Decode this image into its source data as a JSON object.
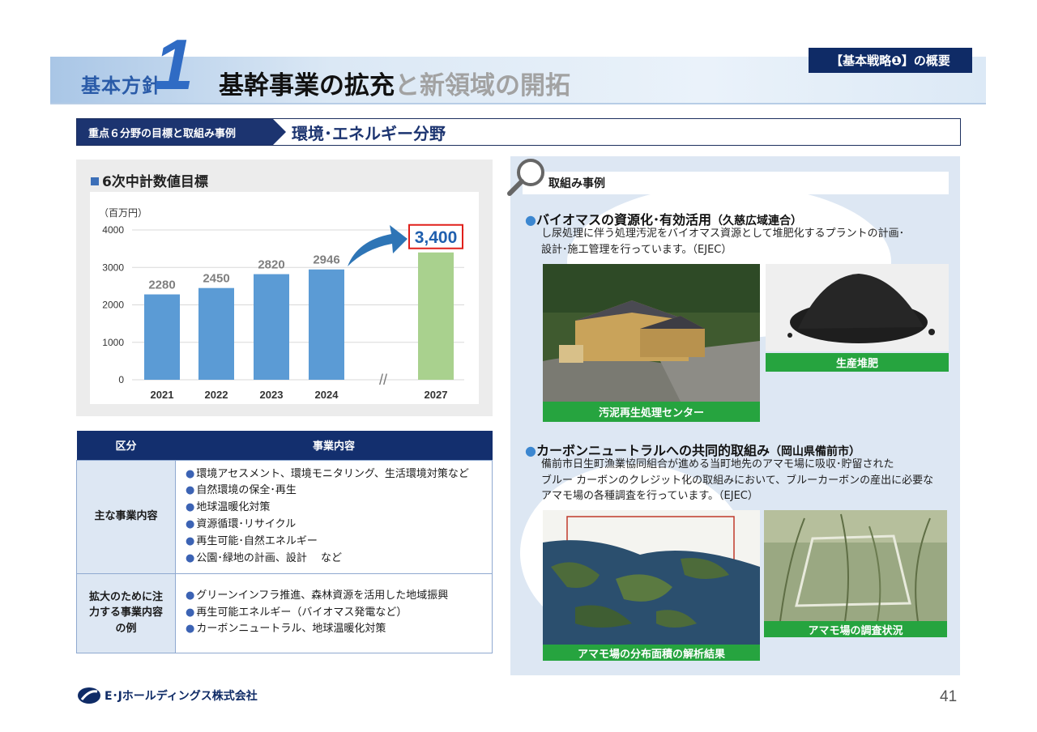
{
  "header": {
    "policy_label": "基本方針",
    "policy_number": "1",
    "title_main": "基幹事業の拡充",
    "title_gray": "と新領域の開拓",
    "badge": "【基本戦略❶】の概要"
  },
  "section": {
    "label": "重点６分野の目標と取組み事例",
    "title": "環境･エネルギー分野"
  },
  "chart": {
    "heading": "6次中計数値目標",
    "unit": "（百万円）",
    "target_label": "3,400"
  },
  "chart_data": {
    "type": "bar",
    "categories": [
      "2021",
      "2022",
      "2023",
      "2024",
      "2027"
    ],
    "values": [
      2280,
      2450,
      2820,
      2946,
      3400
    ],
    "data_labels": [
      "2280",
      "2450",
      "2820",
      "2946",
      "3,400"
    ],
    "ylim": [
      0,
      4000
    ],
    "yticks": [
      "0",
      "1000",
      "2000",
      "3000",
      "4000"
    ],
    "colors": {
      "actual": "#5b9bd5",
      "target": "#a9d18e",
      "arrow": "#2e75b6",
      "target_box": "#e0201b"
    },
    "axis_break": "//",
    "grid": true
  },
  "table": {
    "headers": [
      "区分",
      "事業内容"
    ],
    "rows": [
      {
        "category": "主な事業内容",
        "items": [
          "環境アセスメント、環境モニタリング、生活環境対策など",
          "自然環境の保全･再生",
          "地球温暖化対策",
          "資源循環･リサイクル",
          "再生可能･自然エネルギー",
          "公園･緑地の計画、設計　 など"
        ]
      },
      {
        "category": "拡大のために注力する事業内容の例",
        "items": [
          "グリーンインフラ推進、森林資源を活用した地域振興",
          "再生可能エネルギー（バイオマス発電など）",
          "カーボンニュートラル、地球温暖化対策"
        ]
      }
    ],
    "bullet": "●"
  },
  "cases": {
    "heading": "取組み事例",
    "case1": {
      "title": "バイオマスの資源化･有効活用",
      "sub": "（久慈広域連合）",
      "desc_line1": "し尿処理に伴う処理汚泥をバイオマス資源として堆肥化するプラントの計画･",
      "desc_line2": "設計･施工管理を行っています。（EJEC）",
      "photo1_caption": "汚泥再生処理センター",
      "photo2_caption": "生産堆肥"
    },
    "case2": {
      "title": "カーボンニュートラルへの共同的取組み",
      "sub": "（岡山県備前市）",
      "desc_line1": "備前市日生町漁業協同組合が進める当町地先のアマモ場に吸収･貯留された",
      "desc_line2": "ブルー カーボンのクレジット化の取組みにおいて、ブルーカーボンの産出に必要な",
      "desc_line3": "アマモ場の各種調査を行っています。（EJEC）",
      "photo1_caption": "アマモ場の分布面積の解析結果",
      "photo2_caption": "アマモ場の調査状況"
    }
  },
  "footer": {
    "company": "ホールディングス株式会社",
    "logo_text": "E･J",
    "page": "41"
  }
}
